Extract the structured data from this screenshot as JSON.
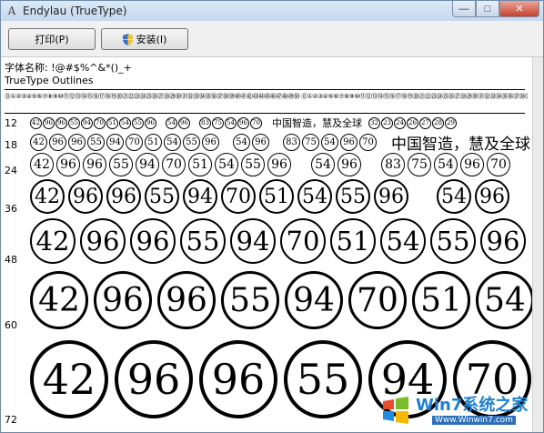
{
  "window": {
    "title": "Endylau (TrueType)",
    "icon": "font-file-icon"
  },
  "controls": {
    "minimize": "—",
    "maximize": "□",
    "close": "✕"
  },
  "toolbar": {
    "print_label": "打印(P)",
    "install_label": "安装(I)"
  },
  "info": {
    "name_line": "字体名称: !@#$%^&*()_+",
    "type_line": "TrueType Outlines"
  },
  "charset": "⓪①②③④⑤⑥⑦⑧⑨⑩⑪⑫⑬⑭⑮⑯⑰⑱⑲⑳㉑㉒㉓㉔㉕㉖㉗㉘㉙㉚㉛㉜㉝㉞㉟㊱㊲㊳㊴㊵㊶㊷㊸㊹㊺㊻㊼㊽㊾㊿ ⓪①②③④⑤⑥⑦⑧⑨⑩⑪⑫⑬⑭⑮⑯⑰⑱⑲⑳㉑㉒㉓㉔㉕㉖㉗㉘㉙㉚㉛㉜㉝㉞㉟㊱㊲㊳㊴㊵㊶",
  "sample": {
    "sizes": [
      "12",
      "18",
      "24",
      "36",
      "48",
      "60",
      "72"
    ],
    "numbers": [
      "42",
      "96",
      "96",
      "55",
      "94",
      "70",
      "51",
      "54",
      "55",
      "96",
      "",
      "54",
      "96",
      "",
      "83",
      "75",
      "54",
      "96",
      "70"
    ],
    "chinese": "中国智造，慧及全球",
    "tail_numbers": [
      "32",
      "23",
      "24",
      "26",
      "27",
      "28",
      "29"
    ]
  },
  "watermark": {
    "brand": "Win7系统之家",
    "url": "Www.Winwin7.com"
  },
  "colors": {
    "title_bg": "#c6d8ee",
    "close_btn": "#c6422d",
    "watermark_blue": "#1e7fd0"
  }
}
